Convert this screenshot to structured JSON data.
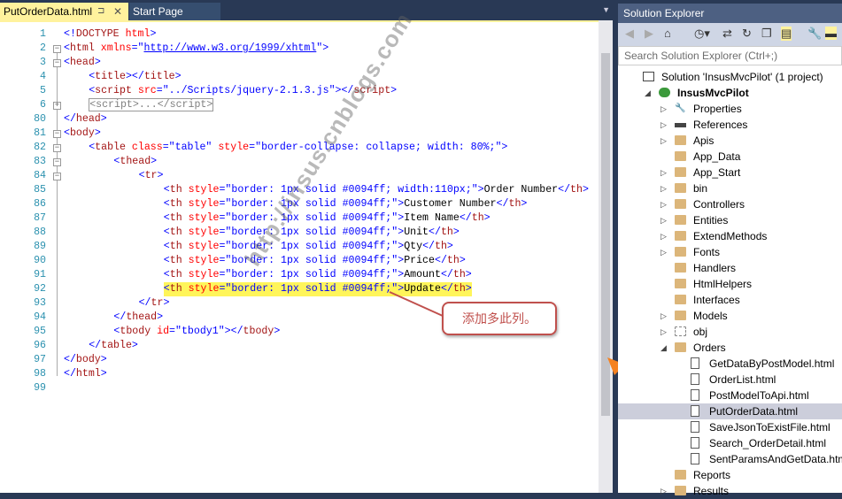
{
  "tabs": {
    "active": "PutOrderData.html",
    "pin": "⊐",
    "close": "✕",
    "inactive": "Start Page",
    "dropdown": "▼"
  },
  "code_lines": [
    {
      "n": "1",
      "fold": "",
      "indent": 0,
      "segs": [
        [
          "b",
          "<!"
        ],
        [
          "t",
          "DOCTYPE "
        ],
        [
          "a",
          "html"
        ],
        [
          "b",
          ">"
        ]
      ]
    },
    {
      "n": "2",
      "fold": "−",
      "indent": 0,
      "segs": [
        [
          "b",
          "<"
        ],
        [
          "t",
          "html "
        ],
        [
          "a",
          "xmlns"
        ],
        [
          "b",
          "=\""
        ],
        [
          "u",
          "http://www.w3.org/1999/xhtml"
        ],
        [
          "b",
          "\">"
        ]
      ]
    },
    {
      "n": "3",
      "fold": "−",
      "indent": 0,
      "segs": [
        [
          "b",
          "<"
        ],
        [
          "t",
          "head"
        ],
        [
          "b",
          ">"
        ]
      ]
    },
    {
      "n": "4",
      "fold": "",
      "indent": 1,
      "segs": [
        [
          "b",
          "<"
        ],
        [
          "t",
          "title"
        ],
        [
          "b",
          "></"
        ],
        [
          "t",
          "title"
        ],
        [
          "b",
          ">"
        ]
      ]
    },
    {
      "n": "5",
      "fold": "",
      "indent": 1,
      "segs": [
        [
          "b",
          "<"
        ],
        [
          "t",
          "script "
        ],
        [
          "a",
          "src"
        ],
        [
          "b",
          "=\""
        ],
        [
          "v",
          "../Scripts/jquery-2.1.3.js"
        ],
        [
          "b",
          "\"></"
        ],
        [
          "t",
          "script"
        ],
        [
          "b",
          ">"
        ]
      ]
    },
    {
      "n": "6",
      "fold": "+",
      "indent": 1,
      "segs": [
        [
          "coll",
          "<script>...</script>"
        ]
      ]
    },
    {
      "n": "80",
      "fold": "",
      "indent": 0,
      "segs": [
        [
          "b",
          "</"
        ],
        [
          "t",
          "head"
        ],
        [
          "b",
          ">"
        ]
      ]
    },
    {
      "n": "81",
      "fold": "−",
      "indent": 0,
      "segs": [
        [
          "b",
          "<"
        ],
        [
          "t",
          "body"
        ],
        [
          "b",
          ">"
        ]
      ]
    },
    {
      "n": "82",
      "fold": "−",
      "indent": 1,
      "segs": [
        [
          "b",
          "<"
        ],
        [
          "t",
          "table "
        ],
        [
          "a",
          "class"
        ],
        [
          "b",
          "=\""
        ],
        [
          "v",
          "table"
        ],
        [
          "b",
          "\" "
        ],
        [
          "a",
          "style"
        ],
        [
          "b",
          "=\""
        ],
        [
          "v",
          "border-collapse: collapse; width: 80%;"
        ],
        [
          "b",
          "\">"
        ]
      ]
    },
    {
      "n": "83",
      "fold": "−",
      "indent": 2,
      "segs": [
        [
          "b",
          "<"
        ],
        [
          "t",
          "thead"
        ],
        [
          "b",
          ">"
        ]
      ]
    },
    {
      "n": "84",
      "fold": "−",
      "indent": 3,
      "segs": [
        [
          "b",
          "<"
        ],
        [
          "t",
          "tr"
        ],
        [
          "b",
          ">"
        ]
      ]
    },
    {
      "n": "85",
      "fold": "",
      "indent": 4,
      "segs": [
        [
          "b",
          "<"
        ],
        [
          "t",
          "th "
        ],
        [
          "a",
          "style"
        ],
        [
          "b",
          "=\""
        ],
        [
          "v",
          "border: 1px solid #0094ff; width:110px;"
        ],
        [
          "b",
          "\">"
        ],
        [
          "p",
          "Order Number"
        ],
        [
          "b",
          "</"
        ],
        [
          "t",
          "th"
        ],
        [
          "b",
          ">"
        ]
      ]
    },
    {
      "n": "86",
      "fold": "",
      "indent": 4,
      "segs": [
        [
          "b",
          "<"
        ],
        [
          "t",
          "th "
        ],
        [
          "a",
          "style"
        ],
        [
          "b",
          "=\""
        ],
        [
          "v",
          "border: 1px solid #0094ff;"
        ],
        [
          "b",
          "\">"
        ],
        [
          "p",
          "Customer Number"
        ],
        [
          "b",
          "</"
        ],
        [
          "t",
          "th"
        ],
        [
          "b",
          ">"
        ]
      ]
    },
    {
      "n": "87",
      "fold": "",
      "indent": 4,
      "segs": [
        [
          "b",
          "<"
        ],
        [
          "t",
          "th "
        ],
        [
          "a",
          "style"
        ],
        [
          "b",
          "=\""
        ],
        [
          "v",
          "border: 1px solid #0094ff;"
        ],
        [
          "b",
          "\">"
        ],
        [
          "p",
          "Item Name"
        ],
        [
          "b",
          "</"
        ],
        [
          "t",
          "th"
        ],
        [
          "b",
          ">"
        ]
      ]
    },
    {
      "n": "88",
      "fold": "",
      "indent": 4,
      "segs": [
        [
          "b",
          "<"
        ],
        [
          "t",
          "th "
        ],
        [
          "a",
          "style"
        ],
        [
          "b",
          "=\""
        ],
        [
          "v",
          "border: 1px solid #0094ff;"
        ],
        [
          "b",
          "\">"
        ],
        [
          "p",
          "Unit"
        ],
        [
          "b",
          "</"
        ],
        [
          "t",
          "th"
        ],
        [
          "b",
          ">"
        ]
      ]
    },
    {
      "n": "89",
      "fold": "",
      "indent": 4,
      "segs": [
        [
          "b",
          "<"
        ],
        [
          "t",
          "th "
        ],
        [
          "a",
          "style"
        ],
        [
          "b",
          "=\""
        ],
        [
          "v",
          "border: 1px solid #0094ff;"
        ],
        [
          "b",
          "\">"
        ],
        [
          "p",
          "Qty"
        ],
        [
          "b",
          "</"
        ],
        [
          "t",
          "th"
        ],
        [
          "b",
          ">"
        ]
      ]
    },
    {
      "n": "90",
      "fold": "",
      "indent": 4,
      "segs": [
        [
          "b",
          "<"
        ],
        [
          "t",
          "th "
        ],
        [
          "a",
          "style"
        ],
        [
          "b",
          "=\""
        ],
        [
          "v",
          "border: 1px solid #0094ff;"
        ],
        [
          "b",
          "\">"
        ],
        [
          "p",
          "Price"
        ],
        [
          "b",
          "</"
        ],
        [
          "t",
          "th"
        ],
        [
          "b",
          ">"
        ]
      ]
    },
    {
      "n": "91",
      "fold": "",
      "indent": 4,
      "segs": [
        [
          "b",
          "<"
        ],
        [
          "t",
          "th "
        ],
        [
          "a",
          "style"
        ],
        [
          "b",
          "=\""
        ],
        [
          "v",
          "border: 1px solid #0094ff;"
        ],
        [
          "b",
          "\">"
        ],
        [
          "p",
          "Amount"
        ],
        [
          "b",
          "</"
        ],
        [
          "t",
          "th"
        ],
        [
          "b",
          ">"
        ]
      ]
    },
    {
      "n": "92",
      "fold": "",
      "indent": 4,
      "hl": true,
      "segs": [
        [
          "b",
          "<"
        ],
        [
          "t",
          "th "
        ],
        [
          "a",
          "style"
        ],
        [
          "b",
          "=\""
        ],
        [
          "v",
          "border: 1px solid #0094ff;"
        ],
        [
          "b",
          "\">"
        ],
        [
          "p",
          "Update"
        ],
        [
          "b",
          "</"
        ],
        [
          "t",
          "th"
        ],
        [
          "b",
          ">"
        ]
      ]
    },
    {
      "n": "93",
      "fold": "",
      "indent": 3,
      "segs": [
        [
          "b",
          "</"
        ],
        [
          "t",
          "tr"
        ],
        [
          "b",
          ">"
        ]
      ]
    },
    {
      "n": "94",
      "fold": "",
      "indent": 2,
      "segs": [
        [
          "b",
          "</"
        ],
        [
          "t",
          "thead"
        ],
        [
          "b",
          ">"
        ]
      ]
    },
    {
      "n": "95",
      "fold": "",
      "indent": 2,
      "segs": [
        [
          "b",
          "<"
        ],
        [
          "t",
          "tbody "
        ],
        [
          "a",
          "id"
        ],
        [
          "b",
          "=\""
        ],
        [
          "v",
          "tbody1"
        ],
        [
          "b",
          "\"></"
        ],
        [
          "t",
          "tbody"
        ],
        [
          "b",
          ">"
        ]
      ]
    },
    {
      "n": "96",
      "fold": "",
      "indent": 1,
      "segs": [
        [
          "b",
          "</"
        ],
        [
          "t",
          "table"
        ],
        [
          "b",
          ">"
        ]
      ]
    },
    {
      "n": "97",
      "fold": "",
      "indent": 0,
      "segs": [
        [
          "b",
          "</"
        ],
        [
          "t",
          "body"
        ],
        [
          "b",
          ">"
        ]
      ]
    },
    {
      "n": "98",
      "fold": "",
      "indent": 0,
      "segs": [
        [
          "b",
          "</"
        ],
        [
          "t",
          "html"
        ],
        [
          "b",
          ">"
        ]
      ]
    },
    {
      "n": "99",
      "fold": "",
      "indent": 0,
      "segs": []
    }
  ],
  "callout": "添加多此列。",
  "watermark": "http://insus.cnblogs.com",
  "solution_explorer": {
    "title": "Solution Explorer",
    "search_placeholder": "Search Solution Explorer (Ctrl+;)",
    "tree": [
      {
        "label": "Solution 'InsusMvcPilot' (1 project)",
        "level": 0,
        "icon": "solution",
        "exp": ""
      },
      {
        "label": "InsusMvcPilot",
        "level": 1,
        "icon": "project",
        "exp": "◢",
        "bold": true
      },
      {
        "label": "Properties",
        "level": 2,
        "icon": "wrench",
        "exp": "▷"
      },
      {
        "label": "References",
        "level": 2,
        "icon": "references",
        "exp": "▷"
      },
      {
        "label": "Apis",
        "level": 2,
        "icon": "folder",
        "exp": "▷"
      },
      {
        "label": "App_Data",
        "level": 2,
        "icon": "folder",
        "exp": ""
      },
      {
        "label": "App_Start",
        "level": 2,
        "icon": "folder",
        "exp": "▷"
      },
      {
        "label": "bin",
        "level": 2,
        "icon": "folder",
        "exp": "▷"
      },
      {
        "label": "Controllers",
        "level": 2,
        "icon": "folder",
        "exp": "▷"
      },
      {
        "label": "Entities",
        "level": 2,
        "icon": "folder",
        "exp": "▷"
      },
      {
        "label": "ExtendMethods",
        "level": 2,
        "icon": "folder",
        "exp": "▷"
      },
      {
        "label": "Fonts",
        "level": 2,
        "icon": "folder",
        "exp": "▷"
      },
      {
        "label": "Handlers",
        "level": 2,
        "icon": "folder",
        "exp": ""
      },
      {
        "label": "HtmlHelpers",
        "level": 2,
        "icon": "folder",
        "exp": ""
      },
      {
        "label": "Interfaces",
        "level": 2,
        "icon": "folder",
        "exp": ""
      },
      {
        "label": "Models",
        "level": 2,
        "icon": "folder",
        "exp": "▷"
      },
      {
        "label": "obj",
        "level": 2,
        "icon": "folder-dashed",
        "exp": "▷"
      },
      {
        "label": "Orders",
        "level": 2,
        "icon": "folder",
        "exp": "◢"
      },
      {
        "label": "GetDataByPostModel.html",
        "level": 3,
        "icon": "file",
        "exp": ""
      },
      {
        "label": "OrderList.html",
        "level": 3,
        "icon": "file",
        "exp": ""
      },
      {
        "label": "PostModelToApi.html",
        "level": 3,
        "icon": "file",
        "exp": ""
      },
      {
        "label": "PutOrderData.html",
        "level": 3,
        "icon": "file",
        "exp": "",
        "selected": true
      },
      {
        "label": "SaveJsonToExistFile.html",
        "level": 3,
        "icon": "file",
        "exp": ""
      },
      {
        "label": "Search_OrderDetail.html",
        "level": 3,
        "icon": "file",
        "exp": ""
      },
      {
        "label": "SentParamsAndGetData.html",
        "level": 3,
        "icon": "file",
        "exp": ""
      },
      {
        "label": "Reports",
        "level": 2,
        "icon": "folder",
        "exp": ""
      },
      {
        "label": "Results",
        "level": 2,
        "icon": "folder",
        "exp": "▷"
      }
    ]
  },
  "colors": {
    "accent": "#fff29d",
    "callout": "#c0504d",
    "arrow": "#f58220"
  }
}
